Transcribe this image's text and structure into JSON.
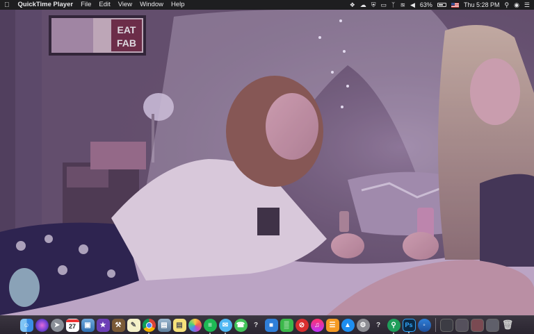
{
  "menubar": {
    "app_name": "QuickTime Player",
    "menus": [
      "File",
      "Edit",
      "View",
      "Window",
      "Help"
    ],
    "battery_percent": "63%",
    "clock": "Thu 5:28 PM"
  },
  "video": {
    "poster_text_line1": "EAT",
    "poster_text_line2": "FAB"
  },
  "dock": {
    "calendar_date": "27",
    "colors": {
      "finder": "#3a8ee6",
      "siri": "#6a3fd0",
      "launchpad": "#8a8f98",
      "chrome": "#e7e7e7",
      "spotify": "#1db954",
      "photoshop": "#0b2a46",
      "photoshop_text": "#31a8ff"
    },
    "icons": [
      "finder-icon",
      "siri-icon",
      "launchpad-icon",
      "calendar-icon",
      "preview-icon",
      "imovie-icon",
      "scripts-icon",
      "notes-icon",
      "chrome-icon",
      "image-capture-icon",
      "stickies-icon",
      "photos-icon",
      "spotify-icon",
      "messages-icon",
      "facetime-icon",
      "unknown-app-icon",
      "keynote-icon",
      "numbers-icon",
      "no-entry-icon",
      "itunes-icon",
      "ibooks-icon",
      "app-store-icon",
      "system-preferences-icon",
      "unknown-app-icon",
      "sourcetree-icon",
      "photoshop-icon",
      "edge-icon",
      "minimized-window",
      "minimized-window",
      "minimized-window",
      "minimized-window",
      "trash-icon"
    ],
    "photoshop_label": "Ps",
    "question_mark": "?"
  }
}
